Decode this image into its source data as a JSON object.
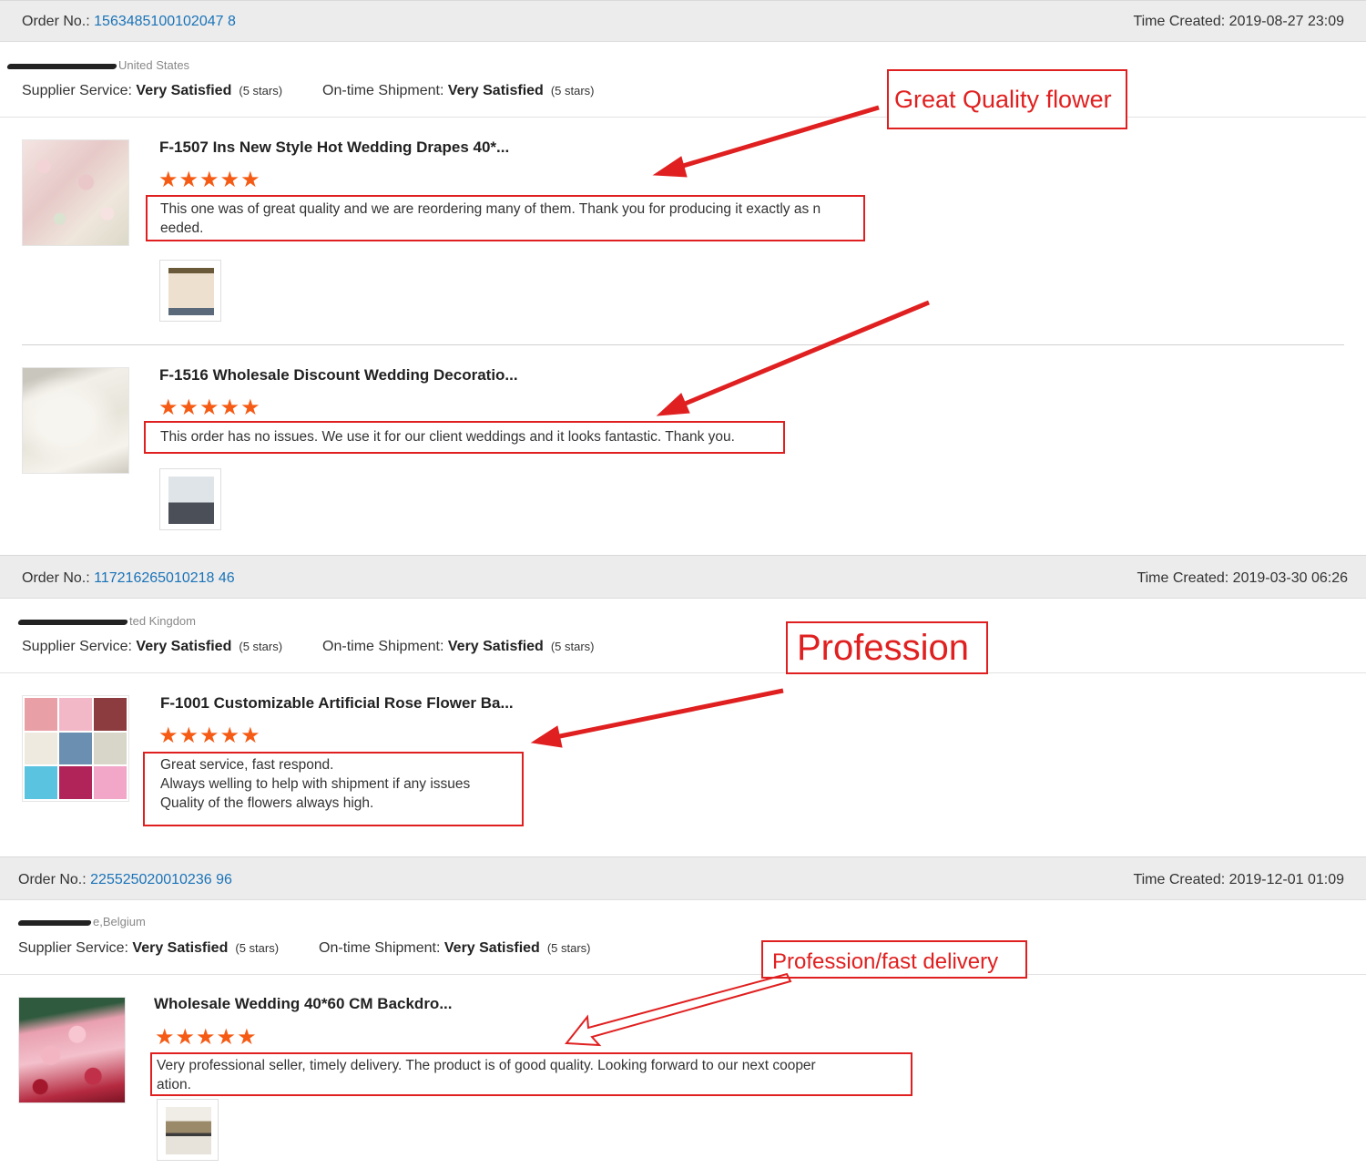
{
  "orders": [
    {
      "order_label": "Order No.:",
      "order_no": "1563485100102047 8",
      "time_label": "Time Created:",
      "time": "2019-08-27 23:09",
      "buyer_suffix": "United States",
      "supplier_label": "Supplier Service:",
      "supplier_value": "Very Satisfied",
      "supplier_stars": "(5 stars)",
      "shipment_label": "On-time Shipment:",
      "shipment_value": "Very Satisfied",
      "shipment_stars": "(5 stars)",
      "items": [
        {
          "title": "F-1507 Ins New Style Hot Wedding Drapes 40*...",
          "stars": "★★★★★",
          "review": "This one was of great quality and we are reordering many of them. Thank you for producing it exactly as n\needed."
        },
        {
          "title": "F-1516 Wholesale Discount Wedding Decoratio...",
          "stars": "★★★★★",
          "review": "This order has no issues. We use it for our client weddings and it looks fantastic. Thank you."
        }
      ]
    },
    {
      "order_label": "Order No.:",
      "order_no": "117216265010218 46",
      "time_label": "Time Created:",
      "time": "2019-03-30 06:26",
      "buyer_suffix": "ted Kingdom",
      "supplier_label": "Supplier Service:",
      "supplier_value": "Very Satisfied",
      "supplier_stars": "(5 stars)",
      "shipment_label": "On-time Shipment:",
      "shipment_value": "Very Satisfied",
      "shipment_stars": "(5 stars)",
      "items": [
        {
          "title": "F-1001 Customizable Artificial Rose Flower Ba...",
          "stars": "★★★★★",
          "review": "Great service, fast respond.\nAlways welling to help with shipment if any issues\nQuality of the flowers always high."
        }
      ]
    },
    {
      "order_label": "Order No.:",
      "order_no": "225525020010236 96",
      "time_label": "Time Created:",
      "time": "2019-12-01 01:09",
      "buyer_suffix": "e,Belgium",
      "supplier_label": "Supplier Service:",
      "supplier_value": "Very Satisfied",
      "supplier_stars": "(5 stars)",
      "shipment_label": "On-time Shipment:",
      "shipment_value": "Very Satisfied",
      "shipment_stars": "(5 stars)",
      "items": [
        {
          "title": "Wholesale Wedding 40*60 CM Backdro...",
          "stars": "★★★★★",
          "review": "Very professional seller, timely delivery. The product is of good quality. Looking forward to our next cooper\nation."
        }
      ]
    }
  ],
  "callouts": {
    "first": "Great Quality flower",
    "second": "Profession",
    "third": "Profession/fast delivery"
  },
  "colors": {
    "accent_red": "#e02020",
    "star_orange": "#f55b14",
    "link_blue": "#1a73b8",
    "header_bg": "#ececec"
  }
}
